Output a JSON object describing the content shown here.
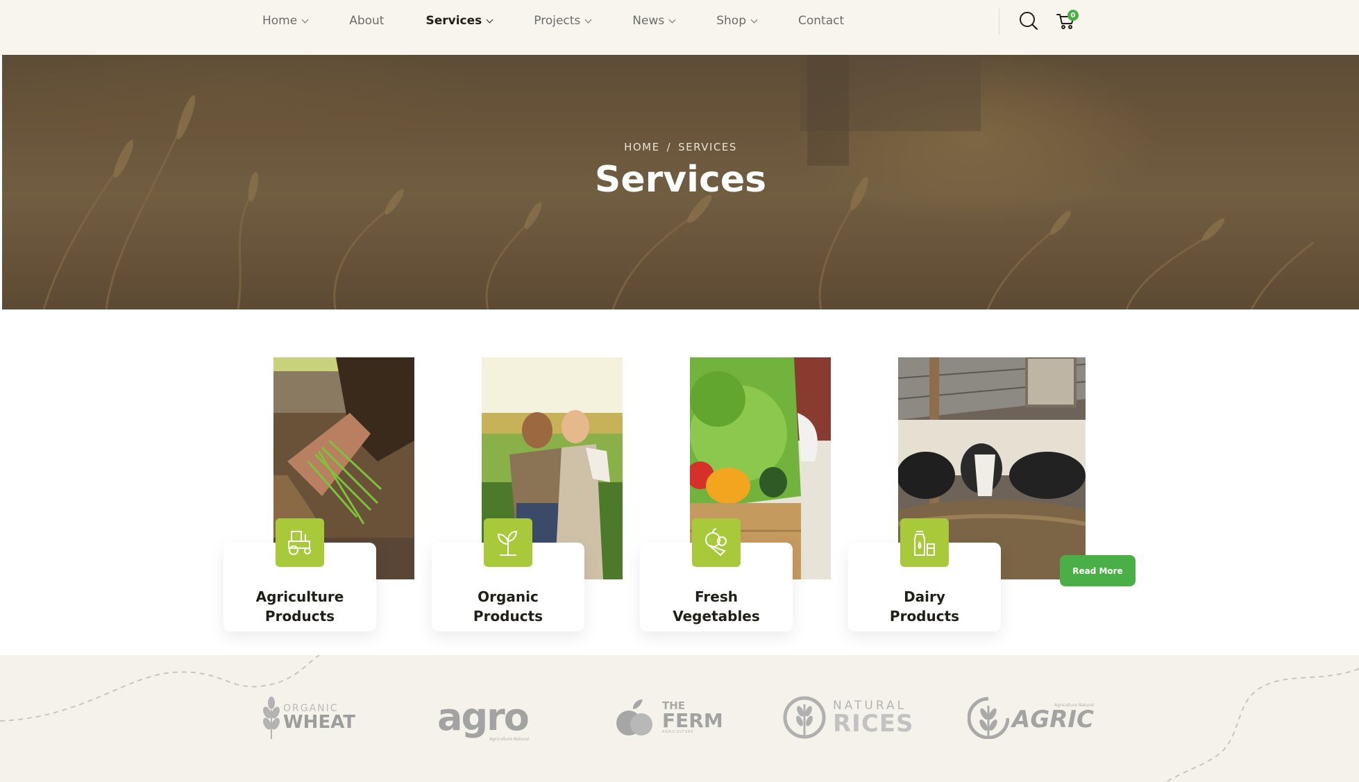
{
  "nav": {
    "items": [
      {
        "label": "Home",
        "dropdown": true,
        "active": false
      },
      {
        "label": "About",
        "dropdown": false,
        "active": false
      },
      {
        "label": "Services",
        "dropdown": true,
        "active": true
      },
      {
        "label": "Projects",
        "dropdown": true,
        "active": false
      },
      {
        "label": "News",
        "dropdown": true,
        "active": false
      },
      {
        "label": "Shop",
        "dropdown": true,
        "active": false
      },
      {
        "label": "Contact",
        "dropdown": false,
        "active": false
      }
    ],
    "cart_count": "0"
  },
  "hero": {
    "breadcrumb": {
      "home": "HOME",
      "separator": "/",
      "current": "SERVICES"
    },
    "title": "Services"
  },
  "services": [
    {
      "line1": "Agriculture",
      "line2": "Products",
      "icon": "tractor-icon"
    },
    {
      "line1": "Organic",
      "line2": "Products",
      "icon": "sprout-icon"
    },
    {
      "line1": "Fresh",
      "line2": "Vegetables",
      "icon": "vegetables-icon"
    },
    {
      "line1": "Dairy",
      "line2": "Products",
      "icon": "milk-icon"
    }
  ],
  "read_more_label": "Read More",
  "brands": [
    {
      "top": "ORGANIC",
      "main": "WHEAT"
    },
    {
      "main": "agro",
      "sub": "Agriculture Natural"
    },
    {
      "top": "THE",
      "main": "FERM",
      "sub": "AGRICULTURE"
    },
    {
      "top": "NATURAL",
      "main": "RICES"
    },
    {
      "top": "Agriculture Natural",
      "main": "AGRIC"
    }
  ],
  "colors": {
    "accent_green": "#4baf47",
    "badge_lime": "#a8c93a",
    "header_bg": "#f7f5ee",
    "brands_bg": "#f4f2ea"
  }
}
